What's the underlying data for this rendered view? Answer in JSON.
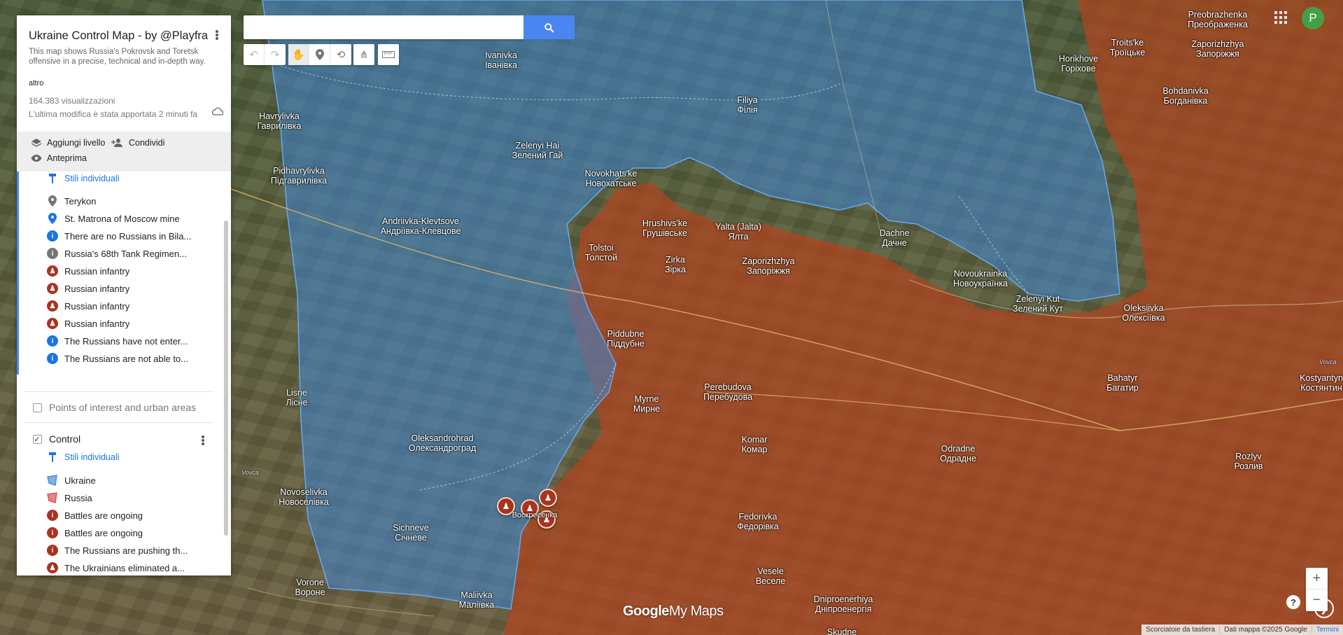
{
  "search": {
    "placeholder": ""
  },
  "panel": {
    "title": "Ukraine Control Map - by @Playfra",
    "description": "This map shows Russia's Pokrovsk and Toretsk offensive in a precise, technical and in-depth way.",
    "more_label": "altro",
    "views": "164.383 visualizzazioni",
    "last_edit": "L'ultima modifica è stata apportata 2 minuti fa",
    "actions": {
      "add_layer": "Aggiungi livello",
      "share": "Condividi",
      "preview": "Anteprima"
    },
    "layer1": {
      "styles_label": "Stili individuali",
      "items": [
        {
          "label": "Terykon",
          "icon": "grey-pin-icon",
          "color": "#757575"
        },
        {
          "label": "St. Matrona of Moscow mine",
          "icon": "blue-pin-icon",
          "color": "#1a73e8"
        },
        {
          "label": "There are no Russians in Bila...",
          "icon": "info-icon",
          "color": "#1a73e8"
        },
        {
          "label": "Russia's 68th Tank Regimen...",
          "icon": "info-icon",
          "color": "#757575"
        },
        {
          "label": "Russian infantry",
          "icon": "infantry-icon",
          "color": "#a8341f"
        },
        {
          "label": "Russian infantry",
          "icon": "infantry-icon",
          "color": "#a8341f"
        },
        {
          "label": "Russian infantry",
          "icon": "infantry-icon",
          "color": "#a8341f"
        },
        {
          "label": "Russian infantry",
          "icon": "infantry-icon",
          "color": "#a8341f"
        },
        {
          "label": "The Russians have not enter...",
          "icon": "info-icon",
          "color": "#1a73e8"
        },
        {
          "label": "The Russians are not able to...",
          "icon": "info-icon",
          "color": "#1a73e8"
        }
      ]
    },
    "poi_layer": {
      "label": "Points of interest and urban areas",
      "checked": false
    },
    "control_layer": {
      "label": "Control",
      "checked": true,
      "styles_label": "Stili individuali",
      "items": [
        {
          "label": "Ukraine",
          "icon": "blue-polygon-icon",
          "color": "#4a90d9"
        },
        {
          "label": "Russia",
          "icon": "red-polygon-icon",
          "color": "#d9534f"
        },
        {
          "label": "Battles are ongoing",
          "icon": "info-icon",
          "color": "#a8341f"
        },
        {
          "label": "Battles are ongoing",
          "icon": "info-icon",
          "color": "#a8341f"
        },
        {
          "label": "The Russians are pushing th...",
          "icon": "info-icon",
          "color": "#a8341f"
        },
        {
          "label": "The Ukrainians eliminated a...",
          "icon": "infantry-icon",
          "color": "#a8341f"
        }
      ]
    }
  },
  "user": {
    "avatar_initial": "P"
  },
  "logo": {
    "google": "Google",
    "mymaps": "My Maps"
  },
  "attribution": {
    "shortcuts": "Scorciatoie da tastiera",
    "data": "Dati mappa ©2025 Google",
    "terms": "Termini"
  },
  "map": {
    "towns": [
      {
        "lat": "Ivanivka",
        "cyr": "Іванівка"
      },
      {
        "lat": "Havrylivka",
        "cyr": "Гаврилівка"
      },
      {
        "lat": "Filiya",
        "cyr": "Філія"
      },
      {
        "lat": "Zelenyi Hai",
        "cyr": "Зелений Гай"
      },
      {
        "lat": "Novokhats'ke",
        "cyr": "Новохатське"
      },
      {
        "lat": "Pidhavrylivka",
        "cyr": "Підгаврилівка"
      },
      {
        "lat": "Andriivka-Klevtsove",
        "cyr": "Андріївка-Клевцове"
      },
      {
        "lat": "Hrushivs'ke",
        "cyr": "Грушівське"
      },
      {
        "lat": "Yalta (Jalta)",
        "cyr": "Ялта"
      },
      {
        "lat": "Tolstoi",
        "cyr": "Толстой"
      },
      {
        "lat": "Zirka",
        "cyr": "Зірка"
      },
      {
        "lat": "Zaporizhzhya",
        "cyr": "Запоріжжя"
      },
      {
        "lat": "Dachne",
        "cyr": "Дачне"
      },
      {
        "lat": "Novoukrainka",
        "cyr": "Новоукраїнка"
      },
      {
        "lat": "Zelenyi Kut",
        "cyr": "Зелений Кут"
      },
      {
        "lat": "Oleksiivka",
        "cyr": "Олексіївка"
      },
      {
        "lat": "Piddubne",
        "cyr": "Піддубне"
      },
      {
        "lat": "Perebudova",
        "cyr": "Перебудова"
      },
      {
        "lat": "Myrne",
        "cyr": "Мирне"
      },
      {
        "lat": "Lisne",
        "cyr": "Лісне"
      },
      {
        "lat": "Bahatyr",
        "cyr": "Багатир"
      },
      {
        "lat": "Kostyantyn",
        "cyr": "Костянтин"
      },
      {
        "lat": "Oleksandrohrad",
        "cyr": "Олександроград"
      },
      {
        "lat": "Komar",
        "cyr": "Комар"
      },
      {
        "lat": "Odradne",
        "cyr": "Одрадне"
      },
      {
        "lat": "Rozlyv",
        "cyr": "Розлив"
      },
      {
        "lat": "Novoselivka",
        "cyr": "Новоселівка"
      },
      {
        "lat": "Sichneve",
        "cyr": "Січневе"
      },
      {
        "lat": "Fedorivka",
        "cyr": "Федорівка"
      },
      {
        "lat": "Vesele",
        "cyr": "Веселе"
      },
      {
        "lat": "Vorone",
        "cyr": "Вороне"
      },
      {
        "lat": "Maliivka",
        "cyr": "Маліївка"
      },
      {
        "lat": "Dniproenerhiya",
        "cyr": "Дніпроенергія"
      },
      {
        "lat": "Preobrazhenka",
        "cyr": "Преображенка"
      },
      {
        "lat": "Troits'ke",
        "cyr": "Троїцьке"
      },
      {
        "lat": "Zaporizhzhya",
        "cyr": "Запоріжжя"
      },
      {
        "lat": "Horikhove",
        "cyr": "Горіхове"
      },
      {
        "lat": "Bohdanivka",
        "cyr": "Богданівка"
      },
      {
        "lat": "Skudne",
        "cyr": ""
      },
      {
        "lat": "Oleksiivka",
        "cyr": "Олексіївка"
      },
      {
        "lat": "nivka",
        "cyr": "оселівка"
      }
    ],
    "marker_partial_label": "Воскресенка",
    "colors": {
      "ukraine": "#3f86d6",
      "russia": "#b2441f"
    }
  }
}
